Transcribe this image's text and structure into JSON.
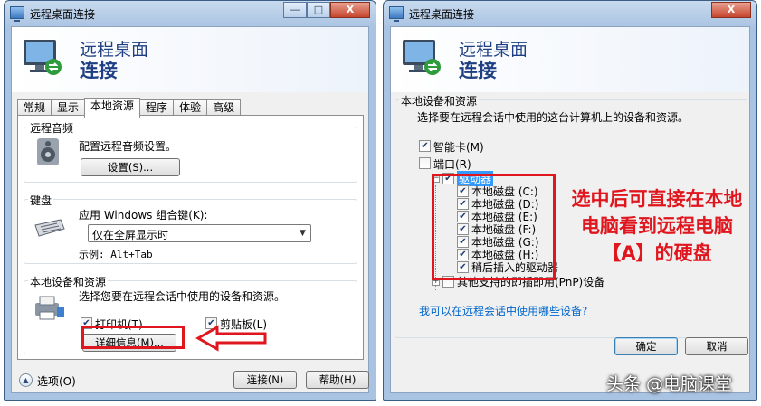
{
  "window_title": "远程桌面连接",
  "window_controls": {
    "minimize": "—",
    "maximize": "□",
    "close": "X"
  },
  "banner": {
    "line1": "远程桌面",
    "line2": "连接"
  },
  "left": {
    "tabs": [
      "常规",
      "显示",
      "本地资源",
      "程序",
      "体验",
      "高级"
    ],
    "active_tab": "本地资源",
    "audio": {
      "title": "远程音频",
      "desc": "配置远程音频设置。",
      "button": "设置(S)..."
    },
    "keyboard": {
      "title": "键盘",
      "desc": "应用 Windows 组合键(K):",
      "selected": "仅在全屏显示时",
      "example": "示例: Alt+Tab"
    },
    "devices": {
      "title": "本地设备和资源",
      "desc": "选择您要在远程会话中使用的设备和资源。",
      "printer": "打印机(T)",
      "clipboard": "剪贴板(L)",
      "details_button": "详细信息(M)..."
    },
    "options": "选项(O)",
    "connect": "连接(N)",
    "help": "帮助(H)"
  },
  "right": {
    "group_title": "本地设备和资源",
    "desc": "选择要在远程会话中使用的这台计算机上的设备和资源。",
    "items": [
      {
        "label": "智能卡(M)",
        "checked": true
      },
      {
        "label": "端口(R)",
        "checked": false
      }
    ],
    "drives": {
      "label": "驱动器",
      "children": [
        "本地磁盘 (C:)",
        "本地磁盘 (D:)",
        "本地磁盘 (E:)",
        "本地磁盘 (F:)",
        "本地磁盘 (G:)",
        "本地磁盘 (H:)",
        "稍后插入的驱动器"
      ]
    },
    "other_pnp": "其他支持的即插即用(PnP)设备",
    "link": "我可以在远程会话中使用哪些设备?",
    "ok": "确定",
    "cancel": "取消"
  },
  "annotation": "选中后可直接在本地电脑看到远程电脑【A】的硬盘",
  "watermark": "头条 @电脑课堂",
  "colors": {
    "annotation_red": "#e0161e",
    "banner_blue": "#1e3f83",
    "link_blue": "#0066cc"
  }
}
